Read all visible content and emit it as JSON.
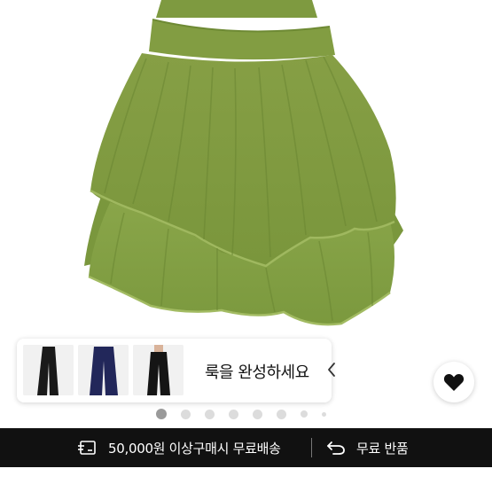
{
  "look": {
    "text": "룩을 완성하세요",
    "thumbs": [
      "black-wide-pants",
      "navy-wide-pants",
      "black-slit-pants"
    ]
  },
  "carousel": {
    "total_dots": 8,
    "active_index": 0
  },
  "shipping": {
    "free_shipping_text": "50,000원 이상구매시 무료배송",
    "free_return_text": "무료 반품"
  },
  "colors": {
    "skirt_green": "#7d9a3e",
    "bar_black": "#111111",
    "dot_active": "#9a9a9a",
    "dot_inactive": "#dcdcdc"
  },
  "icons": {
    "like": "heart-icon",
    "chevron": "chevron-left-icon",
    "shipping": "shipping-box-icon",
    "return": "return-arrow-icon"
  }
}
